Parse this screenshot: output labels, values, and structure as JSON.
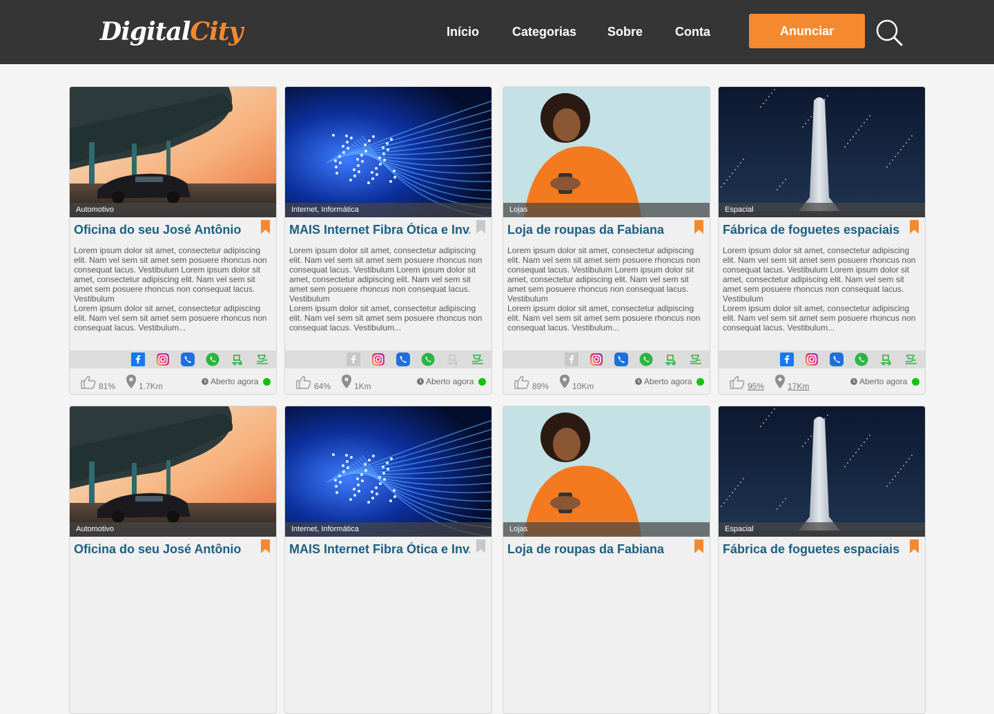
{
  "header": {
    "logo_part1": "Digital",
    "logo_part2": "City",
    "nav": [
      "Início",
      "Categorias",
      "Sobre",
      "Conta"
    ],
    "cta_label": "Anunciar",
    "accent_color": "#f5892f",
    "bar_color": "#353535",
    "search_icon": "search-icon"
  },
  "cards": [
    {
      "category": "Automotivo",
      "title": "Oficina do seu José Antônio",
      "image": "car-under-bridge",
      "bookmarked": true,
      "desc1": "Lorem ipsum dolor sit amet, consectetur adipiscing elit. Nam vel sem sit amet sem posuere rhoncus non consequat lacus. Vestibulum Lorem ipsum dolor sit amet, consectetur adipiscing elit. Nam vel sem sit amet sem posuere rhoncus non consequat lacus. Vestibulum",
      "desc2": "Lorem ipsum dolor sit amet, consectetur adipiscing elit. Nam vel sem sit amet sem posuere rhoncus non consequat lacus. Vestibulum...",
      "social": [
        true,
        true,
        true,
        true,
        true,
        true
      ],
      "rating": "81%",
      "distance": "1.7Km",
      "underline": false,
      "status": "Aberto agora"
    },
    {
      "category": "Internet, Informática",
      "title": "MAIS Internet Fibra Ótica e Inv...",
      "image": "fiber-optics",
      "bookmarked": false,
      "desc1": "Lorem ipsum dolor sit amet, consectetur adipiscing elit. Nam vel sem sit amet sem posuere rhoncus non consequat lacus. Vestibulum Lorem ipsum dolor sit amet, consectetur adipiscing elit. Nam vel sem sit amet sem posuere rhoncus non consequat lacus. Vestibulum",
      "desc2": "Lorem ipsum dolor sit amet, consectetur adipiscing elit. Nam vel sem sit amet sem posuere rhoncus non consequat lacus. Vestibulum...",
      "social": [
        false,
        true,
        true,
        true,
        false,
        true
      ],
      "rating": "64%",
      "distance": "1Km",
      "underline": false,
      "status": "Aberto agora"
    },
    {
      "category": "Lojas",
      "title": "Loja de roupas da Fabiana",
      "image": "woman-with-phone",
      "bookmarked": true,
      "desc1": "Lorem ipsum dolor sit amet, consectetur adipiscing elit. Nam vel sem sit amet sem posuere rhoncus non consequat lacus. Vestibulum Lorem ipsum dolor sit amet, consectetur adipiscing elit. Nam vel sem sit amet sem posuere rhoncus non consequat lacus. Vestibulum",
      "desc2": "Lorem ipsum dolor sit amet, consectetur adipiscing elit. Nam vel sem sit amet sem posuere rhoncus non consequat lacus. Vestibulum...",
      "social": [
        false,
        true,
        true,
        true,
        true,
        true
      ],
      "rating": "89%",
      "distance": "10Km",
      "underline": false,
      "status": "Aberto agora"
    },
    {
      "category": "Espacial",
      "title": "Fábrica de foguetes espaciais",
      "image": "rocket-night",
      "bookmarked": true,
      "desc1": "Lorem ipsum dolor sit amet, consectetur adipiscing elit. Nam vel sem sit amet sem posuere rhoncus non consequat lacus. Vestibulum Lorem ipsum dolor sit amet, consectetur adipiscing elit. Nam vel sem sit amet sem posuere rhoncus non consequat lacus. Vestibulum",
      "desc2": "Lorem ipsum dolor sit amet, consectetur adipiscing elit. Nam vel sem sit amet sem posuere rhoncus non consequat lacus. Vestibulum...",
      "social": [
        true,
        true,
        true,
        true,
        true,
        true
      ],
      "rating": "95%",
      "distance": "17Km",
      "underline": true,
      "status": "Aberto agora"
    },
    {
      "category": "Automotivo",
      "title": "Oficina do seu José Antônio",
      "image": "car-under-bridge",
      "bookmarked": true
    },
    {
      "category": "Internet, Informática",
      "title": "MAIS Internet Fibra Ótica e Inv...",
      "image": "fiber-optics",
      "bookmarked": false
    },
    {
      "category": "Lojas",
      "title": "Loja de roupas da Fabiana",
      "image": "woman-with-phone",
      "bookmarked": true
    },
    {
      "category": "Espacial",
      "title": "Fábrica de foguetes espaciais",
      "image": "rocket-night",
      "bookmarked": true
    }
  ],
  "social_icons": [
    "facebook-icon",
    "instagram-icon",
    "viber-icon",
    "whatsapp-icon",
    "delivery-icon",
    "takeout-icon"
  ],
  "colors": {
    "title": "#1d5f80",
    "status_open": "#12c10e",
    "bookmark_on": "#f5892f",
    "bookmark_off": "#c8c8c8"
  }
}
